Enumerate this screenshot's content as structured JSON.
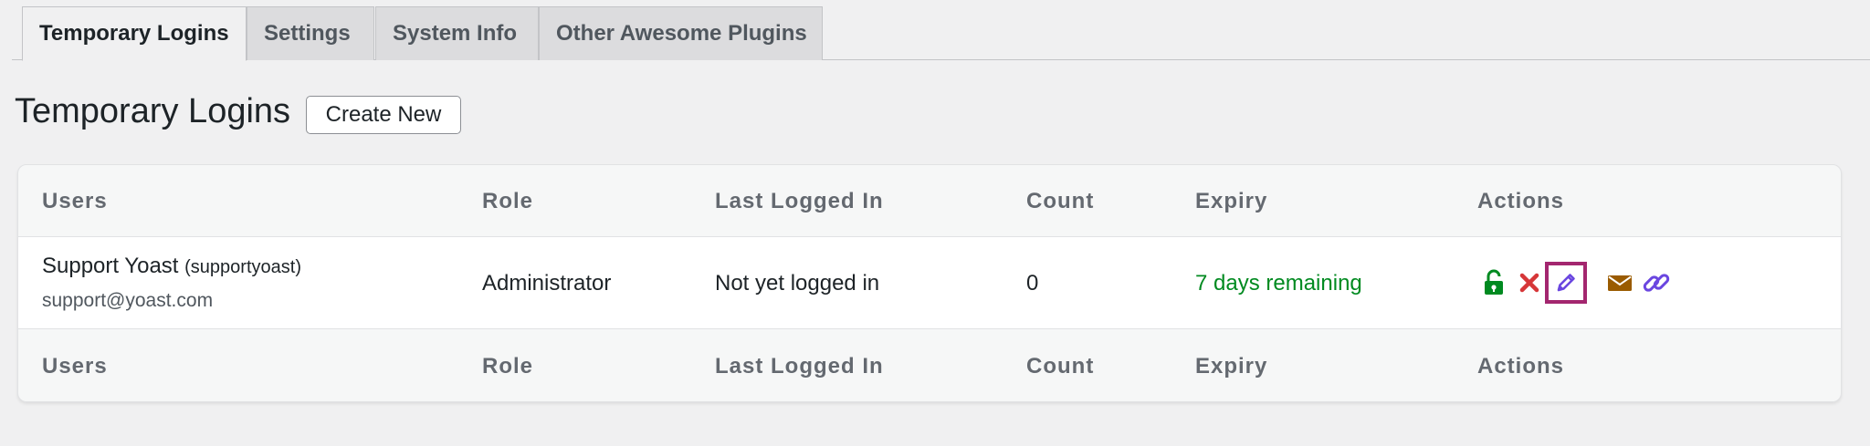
{
  "tabs": [
    {
      "label": "Temporary Logins",
      "active": true
    },
    {
      "label": "Settings",
      "active": false
    },
    {
      "label": "System Info",
      "active": false
    },
    {
      "label": "Other Awesome Plugins",
      "active": false
    }
  ],
  "page": {
    "title": "Temporary Logins",
    "create_button_label": "Create New"
  },
  "table": {
    "columns": [
      "Users",
      "Role",
      "Last Logged In",
      "Count",
      "Expiry",
      "Actions"
    ],
    "rows": [
      {
        "user_name": "Support Yoast",
        "user_login": "(supportyoast)",
        "user_email": "support@yoast.com",
        "role": "Administrator",
        "last_logged_in": "Not yet logged in",
        "count": "0",
        "expiry": "7 days remaining",
        "actions": [
          "unlock-icon",
          "delete-icon",
          "edit-icon",
          "email-icon",
          "link-icon"
        ]
      }
    ]
  },
  "colors": {
    "unlock": "#008a20",
    "delete": "#d63638",
    "edit": "#6a46e0",
    "email": "#9a5b00",
    "link": "#6a46e0",
    "highlight": "#a3266f",
    "expiry_text": "#008a20"
  }
}
